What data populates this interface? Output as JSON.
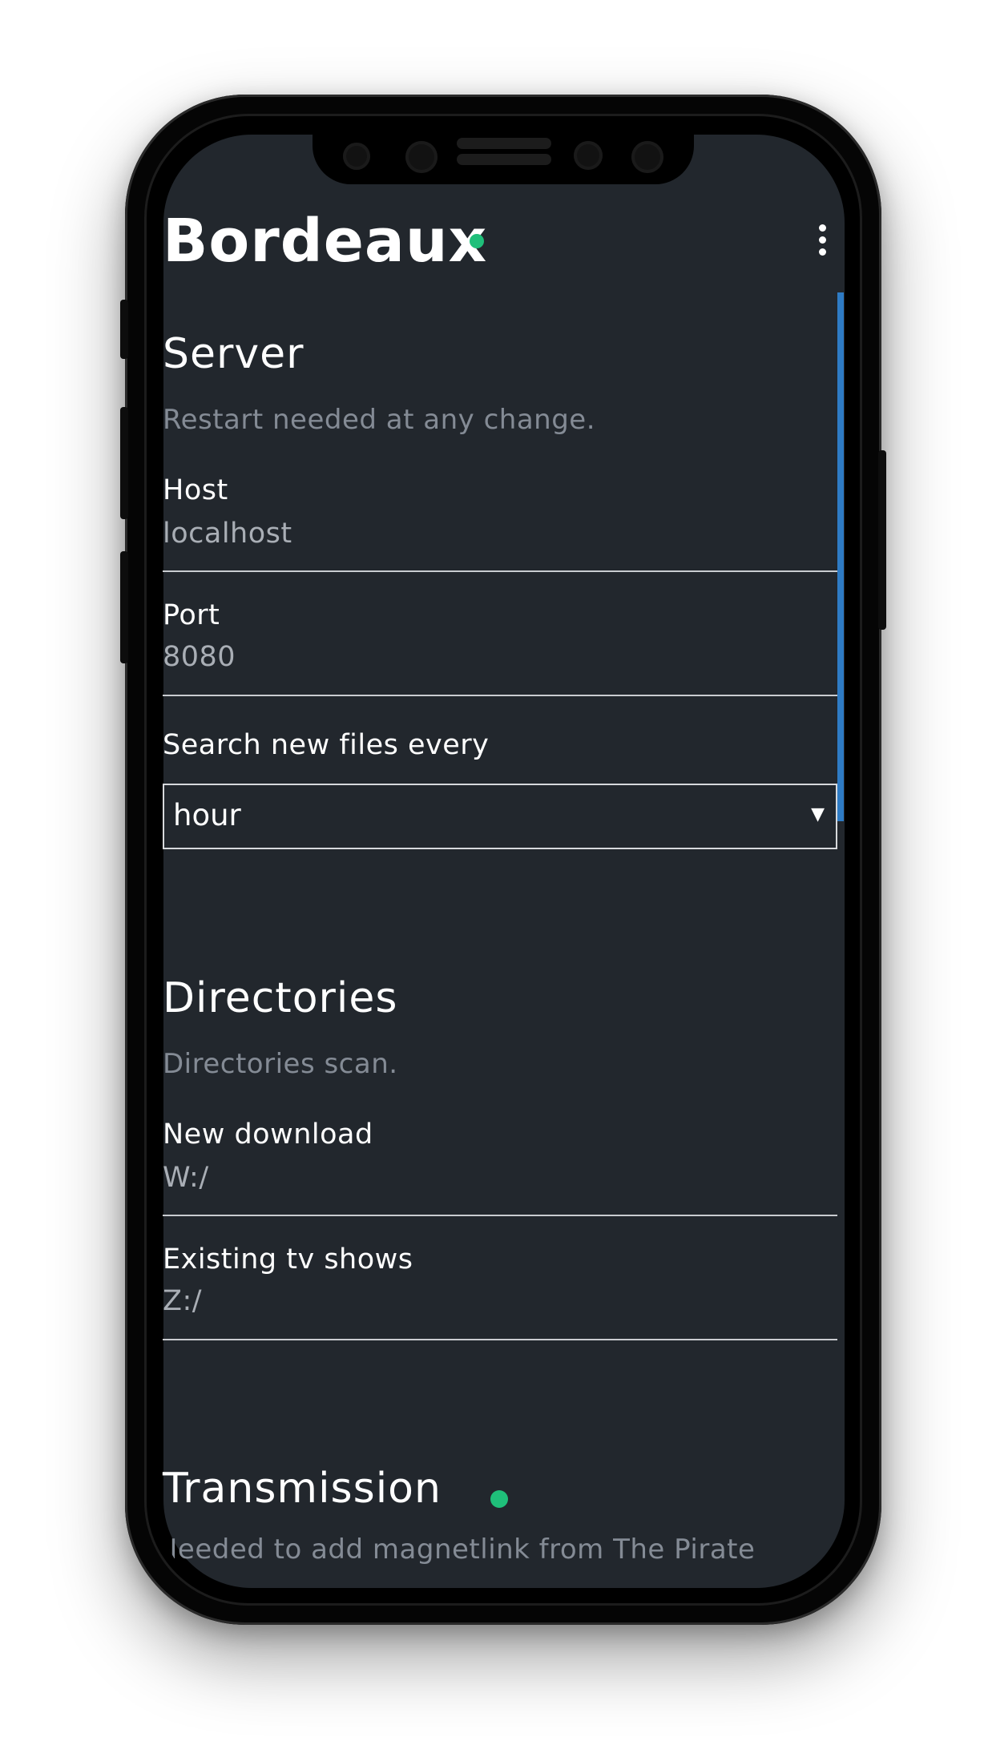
{
  "app": {
    "title": "Bordeaux",
    "status_color": "#1fbf7a"
  },
  "menu": {
    "icon": "more-vert-icon"
  },
  "server": {
    "title": "Server",
    "description": "Restart needed at any change.",
    "host": {
      "label": "Host",
      "value": "localhost"
    },
    "port": {
      "label": "Port",
      "value": "8080"
    },
    "search_interval": {
      "label": "Search new files every",
      "selected": "hour"
    }
  },
  "directories": {
    "title": "Directories",
    "description": "Directories scan.",
    "new_download": {
      "label": "New download",
      "value": "W:/"
    },
    "existing_tv_shows": {
      "label": "Existing tv shows",
      "value": "Z:/"
    }
  },
  "transmission": {
    "title": "Transmission",
    "description": "Needed to add magnetlink from The Pirate",
    "status_color": "#1fbf7a"
  },
  "colors": {
    "background": "#22272d",
    "accent_scrollbar": "#2e7bc4",
    "status_ok": "#1fbf7a"
  }
}
